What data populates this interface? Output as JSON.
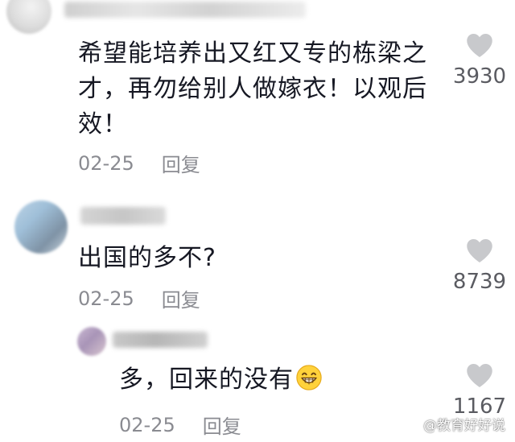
{
  "colors": {
    "text": "#161823",
    "meta": "#8a8b91",
    "heart": "#c8c9cc",
    "like_count": "#5a5b61"
  },
  "comments": [
    {
      "text": "希望能培养出又红又专的栋梁之才，再勿给别人做嫁衣！以观后效！",
      "date": "02-25",
      "reply_label": "回复",
      "likes": "3930",
      "icon": "heart-outline-icon"
    },
    {
      "text": "出国的多不?",
      "date": "02-25",
      "reply_label": "回复",
      "likes": "8739",
      "icon": "heart-outline-icon"
    }
  ],
  "replies": [
    {
      "text": "多，回来的没有",
      "emoji": "grinning-face-emoji",
      "date": "02-25",
      "reply_label": "回复",
      "likes": "1167",
      "icon": "heart-outline-icon"
    }
  ],
  "watermark": {
    "text": "@教育好好说",
    "icon": "toutiao-logo-icon"
  }
}
